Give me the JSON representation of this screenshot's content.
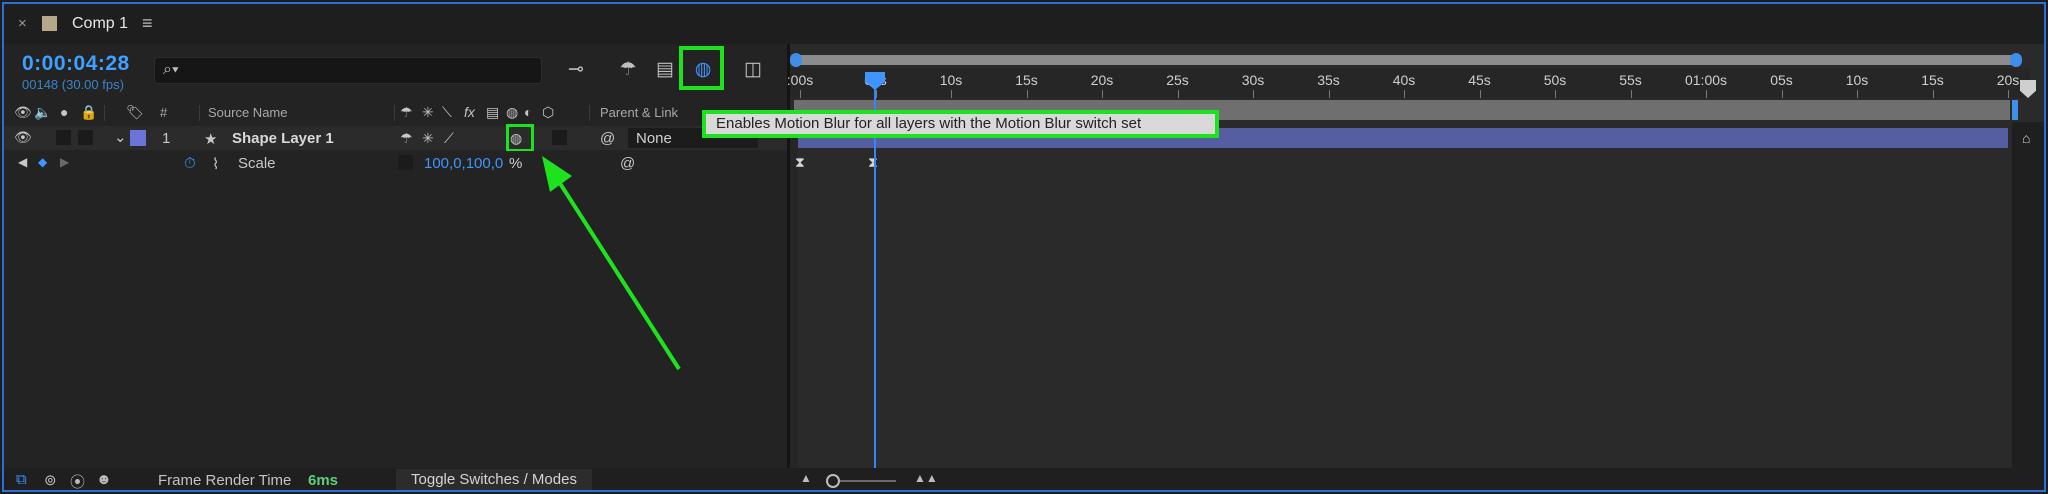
{
  "tab": {
    "close": "×",
    "title": "Comp 1",
    "menu": "≡"
  },
  "header": {
    "timecode": "0:00:04:28",
    "frames": "00148 (30.00 fps)",
    "search_icon": "⌕▾"
  },
  "toolbar": {
    "draft3d_icon": "⊸",
    "shy_icon": "☂",
    "frame_blend_icon": "▤",
    "motion_blur_icon": "◍",
    "graph_icon": "◫"
  },
  "columns": {
    "hash": "#",
    "source_name": "Source Name",
    "parent_link": "Parent & Link",
    "fx": "fx"
  },
  "layer": {
    "number": "1",
    "star": "★",
    "name": "Shape Layer 1",
    "parent_value": "None",
    "label_color": "#6b74d8"
  },
  "property": {
    "name": "Scale",
    "value": "100,0,100,0",
    "unit": "%"
  },
  "ruler": {
    "labels": [
      ":00s",
      "05s",
      "10s",
      "15s",
      "20s",
      "25s",
      "30s",
      "35s",
      "40s",
      "45s",
      "50s",
      "55s",
      "01:00s",
      "05s",
      "10s",
      "15s",
      "20s"
    ]
  },
  "tooltip": "Enables Motion Blur for all layers with the Motion Blur switch set",
  "bottom": {
    "frame_render_label": "Frame Render Time",
    "frame_render_value": "6ms",
    "toggle_label": "Toggle Switches / Modes"
  },
  "colors": {
    "accent": "#3f94ff",
    "highlight": "#1ee21e",
    "layer_bar": "#545ea0"
  }
}
